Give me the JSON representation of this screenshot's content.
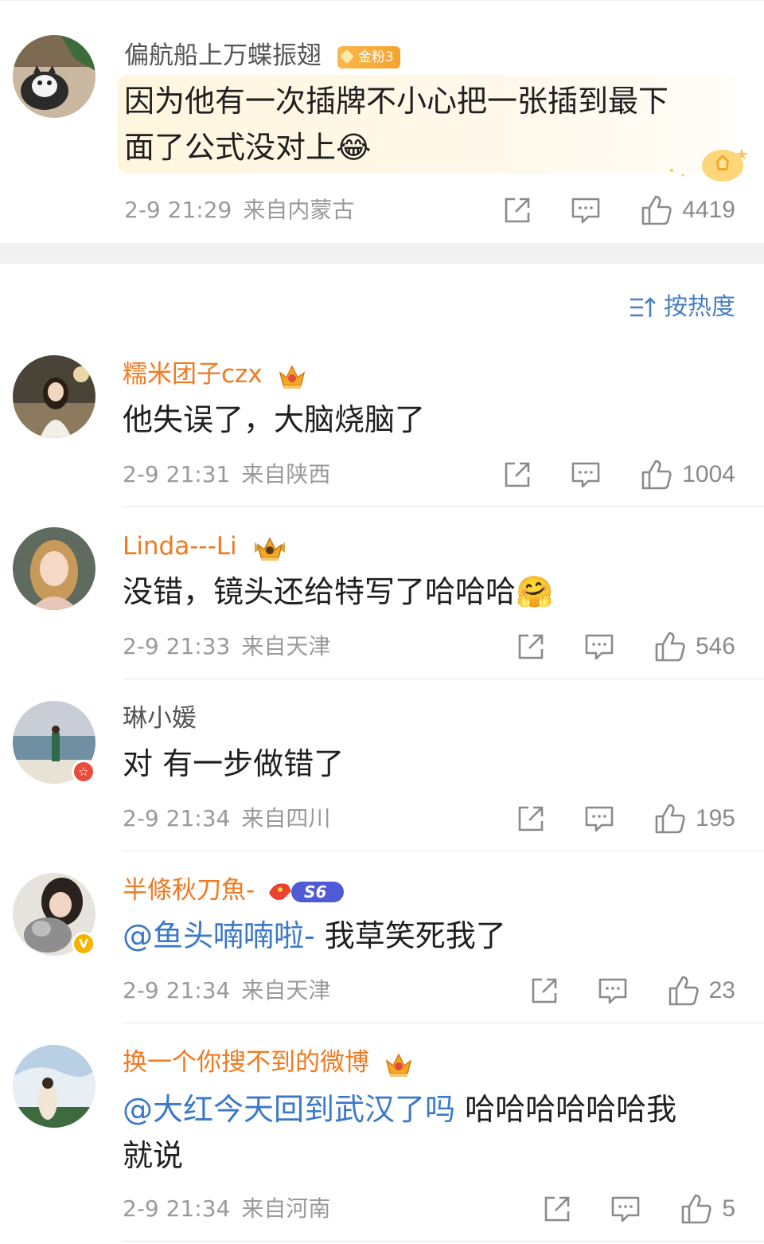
{
  "top_comment": {
    "username": "偏航船上万蝶振翅",
    "fan_badge": "金粉3",
    "text_line1": "因为他有一次插牌不小心把一张插到最下",
    "text_line2": "面了公式没对上",
    "emoji": "😂",
    "time": "2-9 21:29",
    "location": "来自内蒙古",
    "likes": "4419"
  },
  "sort": {
    "label": "按热度",
    "icon": "sort-icon"
  },
  "comments": [
    {
      "username": "糯米团子czx",
      "text": "他失误了，大脑烧脑了",
      "time": "2-9 21:31",
      "location": "来自陕西",
      "likes": "1004"
    },
    {
      "username": "Linda---Li",
      "text": "没错，镜头还给特写了哈哈哈",
      "emoji": "🤗",
      "time": "2-9 21:33",
      "location": "来自天津",
      "likes": "546"
    },
    {
      "username": "琳小媛",
      "text": "对 有一步做错了",
      "time": "2-9 21:34",
      "location": "来自四川",
      "likes": "195"
    },
    {
      "username": "半條秋刀魚-",
      "level_badge": "S6",
      "mention": "@鱼头喃喃啦-",
      "text": " 我草笑死我了",
      "time": "2-9 21:34",
      "location": "来自天津",
      "likes": "23"
    },
    {
      "username": "换一个你搜不到的微博",
      "mention": "@大红今天回到武汉了吗",
      "text": " 哈哈哈哈哈哈我",
      "text_line2": "就说",
      "time": "2-9 21:34",
      "location": "来自河南",
      "likes": "5"
    }
  ],
  "colors": {
    "username_vip": "#f07a22",
    "mention": "#3b78c7",
    "meta": "#9a9a9a",
    "sort": "#4a7fc1"
  }
}
